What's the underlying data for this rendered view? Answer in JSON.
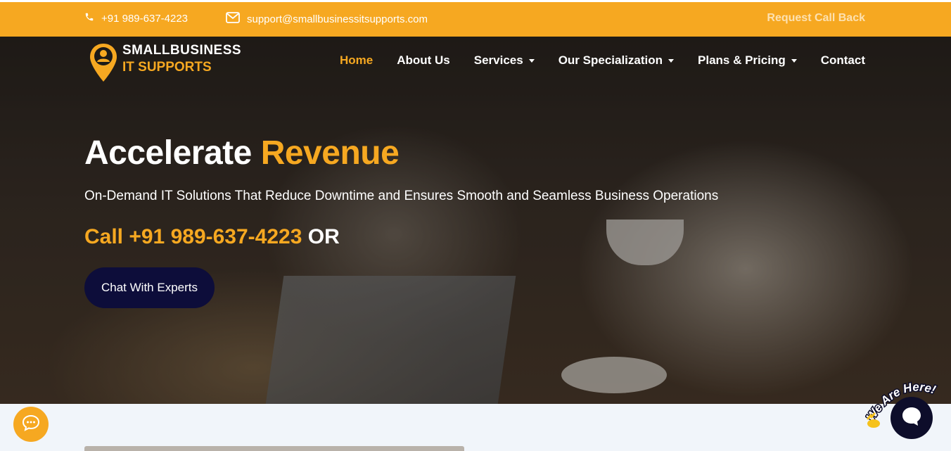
{
  "topbar": {
    "phone": "+91 989-637-4223",
    "email": "support@smallbusinessitsupports.com",
    "callback_label": "Request Call Back"
  },
  "logo": {
    "line1": "SMALLBUSINESS",
    "line2": "IT SUPPORTS"
  },
  "nav": {
    "items": [
      {
        "label": "Home"
      },
      {
        "label": "About Us"
      },
      {
        "label": "Services"
      },
      {
        "label": "Our Specialization"
      },
      {
        "label": "Plans & Pricing"
      },
      {
        "label": "Contact"
      }
    ]
  },
  "hero": {
    "headline_white": "Accelerate",
    "headline_orange": "Revenue",
    "subline": "On-Demand IT Solutions That Reduce Downtime and Ensures Smooth and Seamless Business Operations",
    "call_text": "Call +91 989-637-4223",
    "or_text": "OR",
    "chat_button": "Chat With Experts"
  },
  "widgets": {
    "we_are_here": "We Are Here!"
  },
  "colors": {
    "accent": "#f6a821",
    "navy": "#0d0d3a",
    "background": "#f1f5fa"
  },
  "icons": [
    "phone-icon",
    "envelope-icon",
    "logo-pin-icon",
    "chat-bubble-icon",
    "live-chat-icon",
    "wave-hand-icon"
  ]
}
